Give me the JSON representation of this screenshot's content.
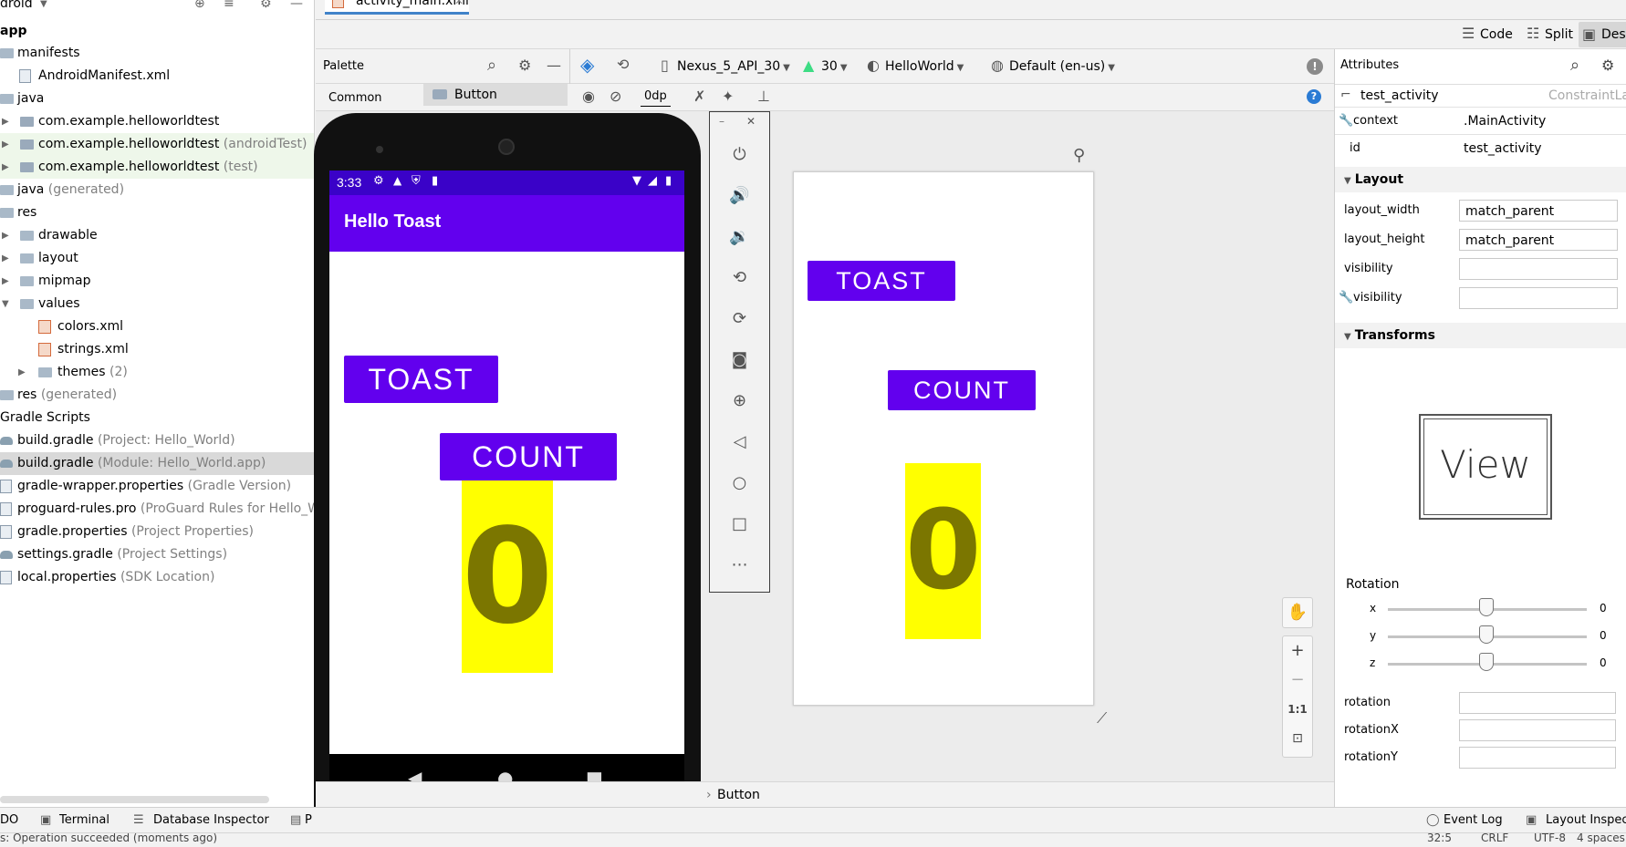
{
  "project": {
    "header_partial": "droid",
    "items": [
      {
        "label": "app",
        "note": ""
      },
      {
        "label": "manifests",
        "note": ""
      },
      {
        "label": "AndroidManifest.xml",
        "note": ""
      },
      {
        "label": "java",
        "note": ""
      },
      {
        "label": "com.example.helloworldtest",
        "note": ""
      },
      {
        "label": "com.example.helloworldtest",
        "note": "(androidTest)"
      },
      {
        "label": "com.example.helloworldtest",
        "note": "(test)"
      },
      {
        "label": "java",
        "note": "(generated)"
      },
      {
        "label": "res",
        "note": ""
      },
      {
        "label": "drawable",
        "note": ""
      },
      {
        "label": "layout",
        "note": ""
      },
      {
        "label": "mipmap",
        "note": ""
      },
      {
        "label": "values",
        "note": ""
      },
      {
        "label": "colors.xml",
        "note": ""
      },
      {
        "label": "strings.xml",
        "note": ""
      },
      {
        "label": "themes",
        "note": "(2)"
      },
      {
        "label": "res",
        "note": "(generated)"
      },
      {
        "label": "Gradle Scripts",
        "note": ""
      },
      {
        "label": "build.gradle",
        "note": "(Project: Hello_World)"
      },
      {
        "label": "build.gradle",
        "note": "(Module: Hello_World.app)"
      },
      {
        "label": "gradle-wrapper.properties",
        "note": "(Gradle Version)"
      },
      {
        "label": "proguard-rules.pro",
        "note": "(ProGuard Rules for Hello_Wo"
      },
      {
        "label": "gradle.properties",
        "note": "(Project Properties)"
      },
      {
        "label": "settings.gradle",
        "note": "(Project Settings)"
      },
      {
        "label": "local.properties",
        "note": "(SDK Location)"
      }
    ]
  },
  "editor": {
    "tab": "activity_main.xml",
    "mode_code": "Code",
    "mode_split": "Split",
    "mode_design": "Des"
  },
  "palette": {
    "title": "Palette",
    "category": "Common",
    "item": "Button"
  },
  "toolbar": {
    "device": "Nexus_5_API_30",
    "api": "30",
    "theme": "HelloWorld",
    "locale": "Default (en-us)",
    "margin": "0dp"
  },
  "phone": {
    "time": "3:33",
    "app_title": "Hello Toast",
    "toast_label": "TOAST",
    "count_label": "COUNT",
    "count_value": "0"
  },
  "preview": {
    "toast_label": "TOAST",
    "count_label": "COUNT",
    "count_value": "0"
  },
  "attributes": {
    "title": "Attributes",
    "component": "test_activity",
    "component_type": "ConstraintLay",
    "partial_row_label": "layout_height",
    "partial_row_value": "match_parent",
    "context_label": "context",
    "context_value": ".MainActivity",
    "id_label": "id",
    "id_value": "test_activity",
    "layout_section": "Layout",
    "layout_width_label": "layout_width",
    "layout_width_value": "match_parent",
    "layout_height_label": "layout_height",
    "layout_height_value": "match_parent",
    "visibility_label": "visibility",
    "visibility_value": "",
    "tools_visibility_label": "visibility",
    "tools_visibility_value": "",
    "transforms_section": "Transforms",
    "view_preview": "View",
    "rotation_title": "Rotation",
    "rot_x_label": "x",
    "rot_x_value": "0",
    "rot_y_label": "y",
    "rot_y_value": "0",
    "rot_z_label": "z",
    "rot_z_value": "0",
    "rotation_label": "rotation",
    "rotationX_label": "rotationX",
    "rotationY_label": "rotationY"
  },
  "breadcrumb": {
    "item": "Button"
  },
  "bottom_tabs": {
    "todo": "DO",
    "terminal": "Terminal",
    "database": "Database Inspector",
    "p": "P",
    "event_log": "Event Log",
    "layout_inspector": "Layout Inspect"
  },
  "status": {
    "message": "s: Operation succeeded (moments ago)",
    "position": "32:5",
    "line_sep": "CRLF",
    "encoding": "UTF-8",
    "indent": "4 spaces"
  },
  "colors": {
    "accent_purple": "#6200ee",
    "status_purple": "#3a02c8",
    "count_yellow": "#ffff00",
    "count_text": "#7b7600"
  }
}
